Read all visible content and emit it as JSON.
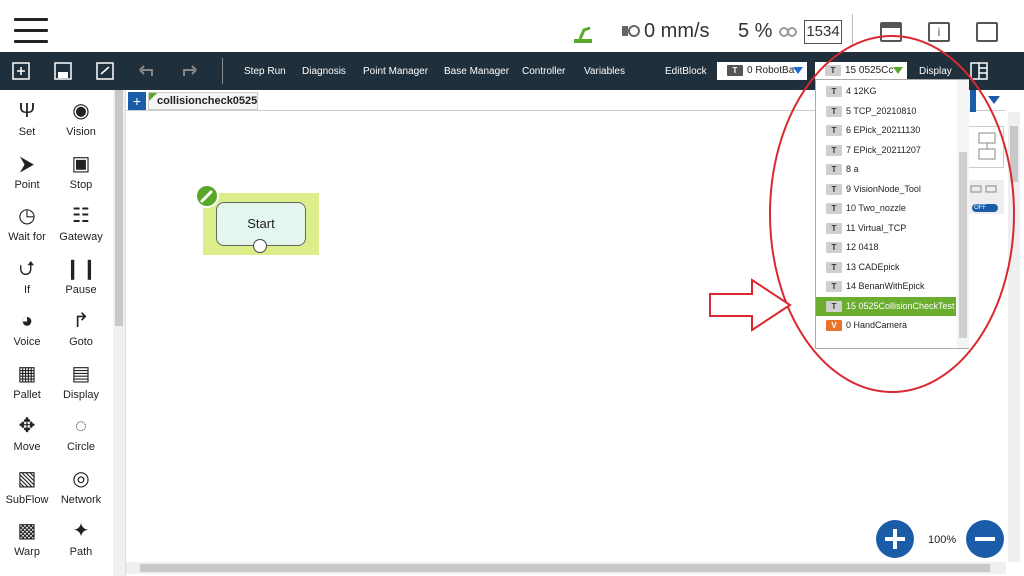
{
  "status": {
    "speed": "0 mm/s",
    "percent": "5 %",
    "code": "1534"
  },
  "toolbar": {
    "items": [
      "Step Run",
      "Diagnosis",
      "Point Manager",
      "Base Manager",
      "Controller",
      "Variables"
    ],
    "editblock": "EditBlock",
    "base_select_badge": "T",
    "base_select": "0 RobotBa",
    "tcp_select_badge": "T",
    "tcp_select": "15 0525Cc",
    "display": "Display"
  },
  "tools": [
    {
      "label": "Set",
      "icon": "set-icon"
    },
    {
      "label": "Vision",
      "icon": "vision-icon"
    },
    {
      "label": "Point",
      "icon": "point-icon"
    },
    {
      "label": "Stop",
      "icon": "stop-icon"
    },
    {
      "label": "Wait for",
      "icon": "wait-for-icon"
    },
    {
      "label": "Gateway",
      "icon": "gateway-icon"
    },
    {
      "label": "If",
      "icon": "if-icon"
    },
    {
      "label": "Pause",
      "icon": "pause-icon"
    },
    {
      "label": "Voice",
      "icon": "voice-icon"
    },
    {
      "label": "Goto",
      "icon": "goto-icon"
    },
    {
      "label": "Pallet",
      "icon": "pallet-icon"
    },
    {
      "label": "Display",
      "icon": "display-icon"
    },
    {
      "label": "Move",
      "icon": "move-icon"
    },
    {
      "label": "Circle",
      "icon": "circle-icon"
    },
    {
      "label": "SubFlow",
      "icon": "subflow-icon"
    },
    {
      "label": "Network",
      "icon": "network-icon"
    },
    {
      "label": "Warp",
      "icon": "warp-icon"
    },
    {
      "label": "Path",
      "icon": "path-icon"
    }
  ],
  "tab": {
    "plus": "+",
    "name": "collisioncheck0525"
  },
  "flow": {
    "start_label": "Start"
  },
  "dropdown": {
    "items": [
      {
        "badge": "T",
        "label": "4  12KG"
      },
      {
        "badge": "T",
        "label": "5  TCP_20210810"
      },
      {
        "badge": "T",
        "label": "6  EPick_20211130"
      },
      {
        "badge": "T",
        "label": "7  EPick_20211207"
      },
      {
        "badge": "T",
        "label": "8  a"
      },
      {
        "badge": "T",
        "label": "9  VisionNode_Tool"
      },
      {
        "badge": "T",
        "label": "10  Two_nozzle"
      },
      {
        "badge": "T",
        "label": "11  Virtual_TCP"
      },
      {
        "badge": "T",
        "label": "12  0418"
      },
      {
        "badge": "T",
        "label": "13  CADEpick"
      },
      {
        "badge": "T",
        "label": "14  BenanWithEpick"
      },
      {
        "badge": "T",
        "label": "15  0525CollisionCheckTest",
        "selected": true
      },
      {
        "badge": "V",
        "label": "0  HandCamera"
      }
    ]
  },
  "mini": {
    "off": "OFF"
  },
  "zoom": {
    "percent": "100%"
  },
  "colors": {
    "toolbar_bg": "#1f2f3b",
    "accent_blue": "#1a5ca8",
    "selected_green": "#6aad2f",
    "annotation_red": "#d9282f"
  }
}
